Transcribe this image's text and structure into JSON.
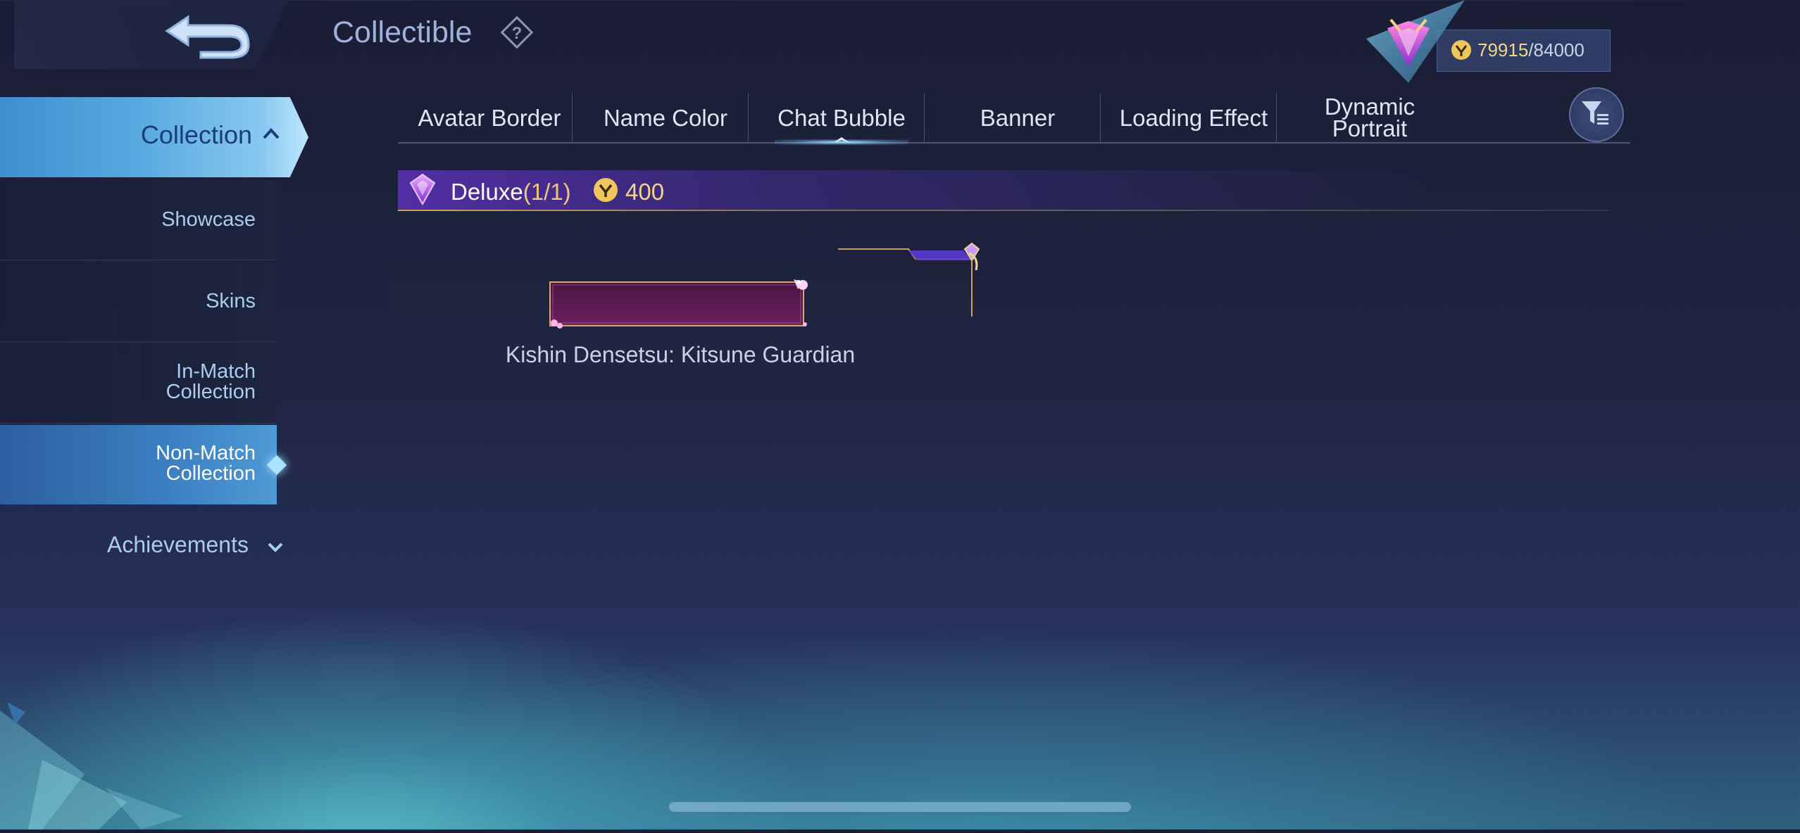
{
  "header": {
    "title": "Collectible",
    "currency": {
      "current": "79915",
      "separator": "/",
      "max": "84000"
    }
  },
  "sidebar": {
    "collection_label": "Collection",
    "items": [
      {
        "label": "Showcase"
      },
      {
        "label": "Skins"
      },
      {
        "label": "In-Match\nCollection"
      },
      {
        "label": "Non-Match\nCollection"
      }
    ],
    "achievements_label": "Achievements"
  },
  "tabs": [
    {
      "label": "Avatar Border"
    },
    {
      "label": "Name Color"
    },
    {
      "label": "Chat Bubble"
    },
    {
      "label": "Banner"
    },
    {
      "label": "Loading Effect"
    },
    {
      "label": "Dynamic\nPortrait"
    }
  ],
  "active_tab": "Chat Bubble",
  "active_sidebar_item": "Non-Match\nCollection",
  "section": {
    "label": "Deluxe",
    "count": "(1/1)",
    "price": "400"
  },
  "items": [
    {
      "name": "Kishin Densetsu: Kitsune Guardian"
    }
  ],
  "colors": {
    "accent_blue": "#58a9e0",
    "deluxe_purple": "#5f32be",
    "gold": "#f3d48a",
    "bubble_magenta": "#5a1a4e"
  }
}
